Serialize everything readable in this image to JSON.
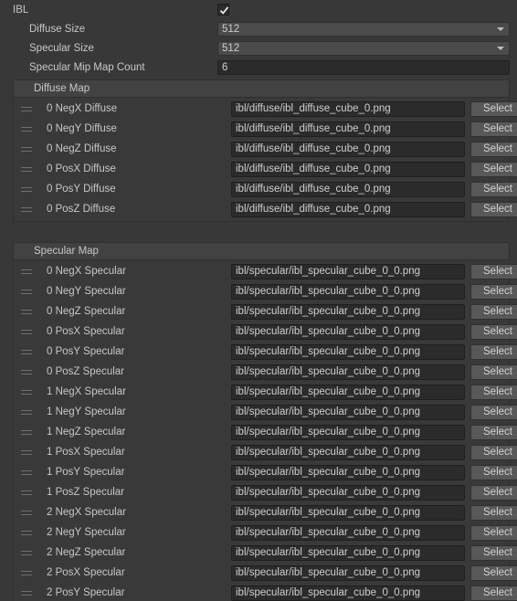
{
  "colors": {
    "window_bg": "#383838",
    "section_bg": "#393939",
    "section_header_bg": "#424242",
    "field_bg": "#2b2b2b",
    "dropdown_bg": "#4b4b4b",
    "button_bg": "#585858",
    "text": "#c8c8c8"
  },
  "properties": {
    "ibl": {
      "label": "IBL",
      "checked": true
    },
    "diffuse_size": {
      "label": "Diffuse Size",
      "value": "512",
      "options": [
        "512"
      ]
    },
    "specular_size": {
      "label": "Specular Size",
      "value": "512",
      "options": [
        "512"
      ]
    },
    "specular_mip_map_count": {
      "label": "Specular Mip Map Count",
      "value": "6"
    }
  },
  "sections": [
    {
      "title": "Diffuse Map",
      "button_label": "Select",
      "rows": [
        {
          "label": "0 NegX Diffuse",
          "path": "ibl/diffuse/ibl_diffuse_cube_0.png"
        },
        {
          "label": "0 NegY Diffuse",
          "path": "ibl/diffuse/ibl_diffuse_cube_0.png"
        },
        {
          "label": "0 NegZ Diffuse",
          "path": "ibl/diffuse/ibl_diffuse_cube_0.png"
        },
        {
          "label": "0 PosX Diffuse",
          "path": "ibl/diffuse/ibl_diffuse_cube_0.png"
        },
        {
          "label": "0 PosY Diffuse",
          "path": "ibl/diffuse/ibl_diffuse_cube_0.png"
        },
        {
          "label": "0 PosZ Diffuse",
          "path": "ibl/diffuse/ibl_diffuse_cube_0.png"
        }
      ]
    },
    {
      "title": "Specular Map",
      "button_label": "Select",
      "rows": [
        {
          "label": "0 NegX Specular",
          "path": "ibl/specular/ibl_specular_cube_0_0.png"
        },
        {
          "label": "0 NegY Specular",
          "path": "ibl/specular/ibl_specular_cube_0_0.png"
        },
        {
          "label": "0 NegZ Specular",
          "path": "ibl/specular/ibl_specular_cube_0_0.png"
        },
        {
          "label": "0 PosX Specular",
          "path": "ibl/specular/ibl_specular_cube_0_0.png"
        },
        {
          "label": "0 PosY Specular",
          "path": "ibl/specular/ibl_specular_cube_0_0.png"
        },
        {
          "label": "0 PosZ Specular",
          "path": "ibl/specular/ibl_specular_cube_0_0.png"
        },
        {
          "label": "1 NegX Specular",
          "path": "ibl/specular/ibl_specular_cube_0_0.png"
        },
        {
          "label": "1 NegY Specular",
          "path": "ibl/specular/ibl_specular_cube_0_0.png"
        },
        {
          "label": "1 NegZ Specular",
          "path": "ibl/specular/ibl_specular_cube_0_0.png"
        },
        {
          "label": "1 PosX Specular",
          "path": "ibl/specular/ibl_specular_cube_0_0.png"
        },
        {
          "label": "1 PosY Specular",
          "path": "ibl/specular/ibl_specular_cube_0_0.png"
        },
        {
          "label": "1 PosZ Specular",
          "path": "ibl/specular/ibl_specular_cube_0_0.png"
        },
        {
          "label": "2 NegX Specular",
          "path": "ibl/specular/ibl_specular_cube_0_0.png"
        },
        {
          "label": "2 NegY Specular",
          "path": "ibl/specular/ibl_specular_cube_0_0.png"
        },
        {
          "label": "2 NegZ Specular",
          "path": "ibl/specular/ibl_specular_cube_0_0.png"
        },
        {
          "label": "2 PosX Specular",
          "path": "ibl/specular/ibl_specular_cube_0_0.png"
        },
        {
          "label": "2 PosY Specular",
          "path": "ibl/specular/ibl_specular_cube_0_0.png"
        }
      ]
    }
  ]
}
